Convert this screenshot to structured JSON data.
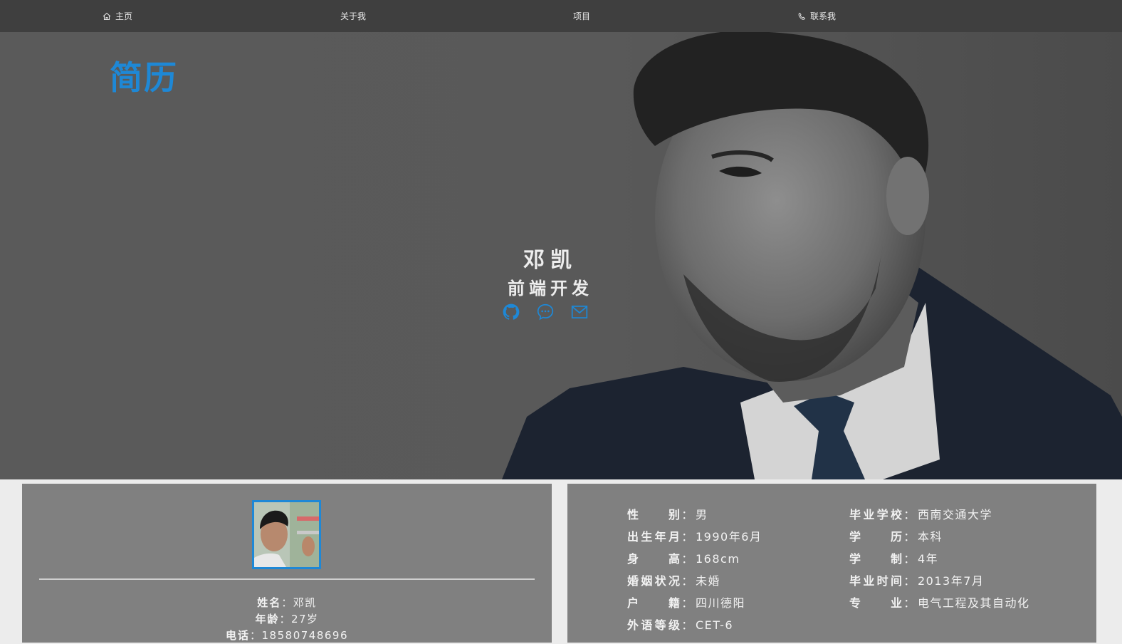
{
  "nav": {
    "items": [
      {
        "label": "主页",
        "icon": "home-icon"
      },
      {
        "label": "关于我"
      },
      {
        "label": "项目"
      },
      {
        "label": "联系我",
        "icon": "phone-icon"
      }
    ]
  },
  "hero": {
    "brand": "简历",
    "name": "邓凯",
    "title": "前端开发",
    "social_icons": [
      "github-icon",
      "wechat-icon",
      "mail-icon"
    ],
    "accent_color": "#1e88d6"
  },
  "profile": {
    "name_label": "姓名",
    "name_value": "邓凯",
    "age_label": "年龄",
    "age_value": "27岁",
    "phone_label": "电话",
    "phone_value": "18580748696",
    "separator": "："
  },
  "details": {
    "left": [
      {
        "label": "性别",
        "value": "男"
      },
      {
        "label": "出生年月",
        "value": "1990年6月"
      },
      {
        "label": "身高",
        "value": "168cm"
      },
      {
        "label": "婚姻状况",
        "value": "未婚"
      },
      {
        "label": "户籍",
        "value": "四川德阳"
      },
      {
        "label": "外语等级",
        "value": "CET-6"
      }
    ],
    "right": [
      {
        "label": "毕业学校",
        "value": "西南交通大学"
      },
      {
        "label": "学历",
        "value": "本科"
      },
      {
        "label": "学制",
        "value": "4年"
      },
      {
        "label": "毕业时间",
        "value": "2013年7月"
      },
      {
        "label": "专业",
        "value": "电气工程及其自动化"
      }
    ]
  }
}
